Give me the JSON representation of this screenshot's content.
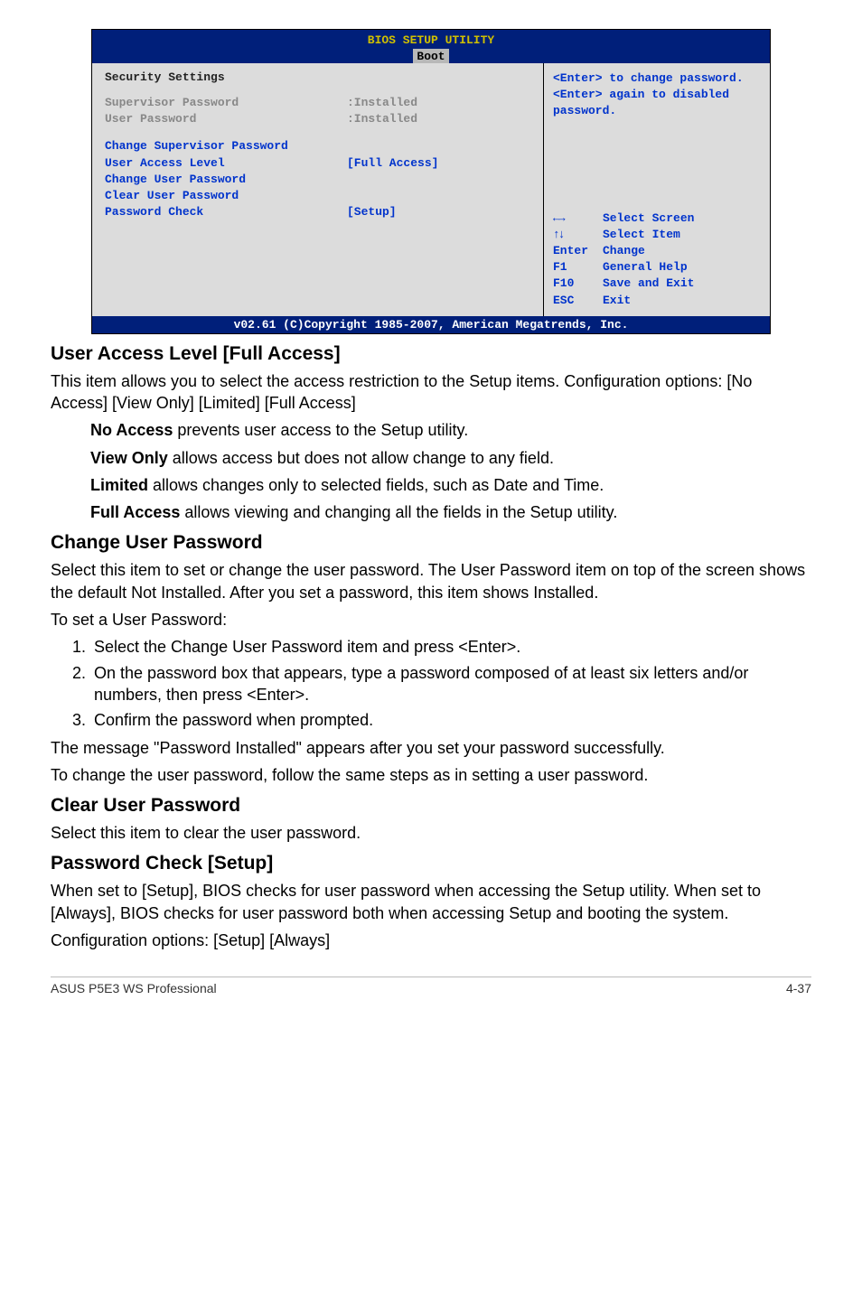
{
  "bios": {
    "title": "BIOS SETUP UTILITY",
    "tab": "Boot",
    "left": {
      "section_title": "Security Settings",
      "supervisor_label": "Supervisor Password",
      "supervisor_value": ":Installed",
      "user_label": "User Password",
      "user_value": ":Installed",
      "change_sup": "Change Supervisor Password",
      "ual_label": "User Access Level",
      "ual_value": "[Full Access]",
      "change_user": "Change User Password",
      "clear_user": "Clear User Password",
      "pwcheck_label": "Password Check",
      "pwcheck_value": "[Setup]"
    },
    "right": {
      "note1": "<Enter> to change password.",
      "note2": "<Enter> again to disabled password.",
      "kh_select_screen": "Select Screen",
      "kh_select_item": "Select Item",
      "kh_enter_key": "Enter",
      "kh_enter_val": "Change",
      "kh_f1_key": "F1",
      "kh_f1_val": "General Help",
      "kh_f10_key": "F10",
      "kh_f10_val": "Save and Exit",
      "kh_esc_key": "ESC",
      "kh_esc_val": "Exit"
    },
    "footer": "v02.61 (C)Copyright 1985-2007, American Megatrends, Inc."
  },
  "doc": {
    "h_ual": "User Access Level [Full Access]",
    "p_ual_1": "This item allows you to select the access restriction to the Setup items. Configuration options: [No Access] [View Only] [Limited] [Full Access]",
    "na_b": "No Access",
    "na_t": " prevents user access to the Setup utility.",
    "vo_b": "View Only",
    "vo_t": " allows access but does not allow change to any field.",
    "li_b": "Limited",
    "li_t": " allows changes only to selected fields, such as Date and Time.",
    "fa_b": "Full Access",
    "fa_t": " allows viewing and changing all the fields in the Setup utility.",
    "h_chg": "Change User Password",
    "p_chg_1": "Select this item to set or change the user password. The User Password item on top of the screen shows the default Not Installed. After you set a password, this item shows Installed.",
    "p_chg_2": "To set a User Password:",
    "ol1": "Select the Change User Password item and press <Enter>.",
    "ol2": "On the password box that appears, type a password composed of at least six letters and/or numbers, then press <Enter>.",
    "ol3": "Confirm the password when prompted.",
    "p_chg_3": "The message \"Password Installed\" appears after you set your password successfully.",
    "p_chg_4": "To change the user password, follow the same steps as in setting a user password.",
    "h_clr": "Clear User Password",
    "p_clr_1": "Select this item to clear the user password.",
    "h_pc": "Password Check [Setup]",
    "p_pc_1": "When set to [Setup], BIOS checks for user password when accessing the Setup utility. When set to [Always], BIOS checks for user password both when accessing Setup and booting the system.",
    "p_pc_2": "Configuration options: [Setup] [Always]",
    "footer_left": "ASUS P5E3 WS Professional",
    "footer_right": "4-37"
  }
}
